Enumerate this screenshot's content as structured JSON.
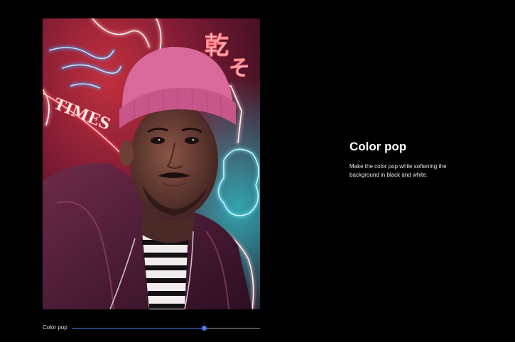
{
  "photo": {
    "neon_sign_text": "TIMES",
    "neon_glyph_1": "乾",
    "neon_glyph_2": "そ"
  },
  "slider": {
    "label": "Color pop",
    "value_fraction": 0.7
  },
  "info": {
    "title": "Color pop",
    "description": "Make the color pop while softening the background in black and white."
  },
  "colors": {
    "accent": "#4c7cf3",
    "background": "#000000",
    "beanie": "#d9699a",
    "neon_blue": "#44a8ff",
    "neon_red": "#ff3c46",
    "neon_white": "#fff4f0"
  }
}
